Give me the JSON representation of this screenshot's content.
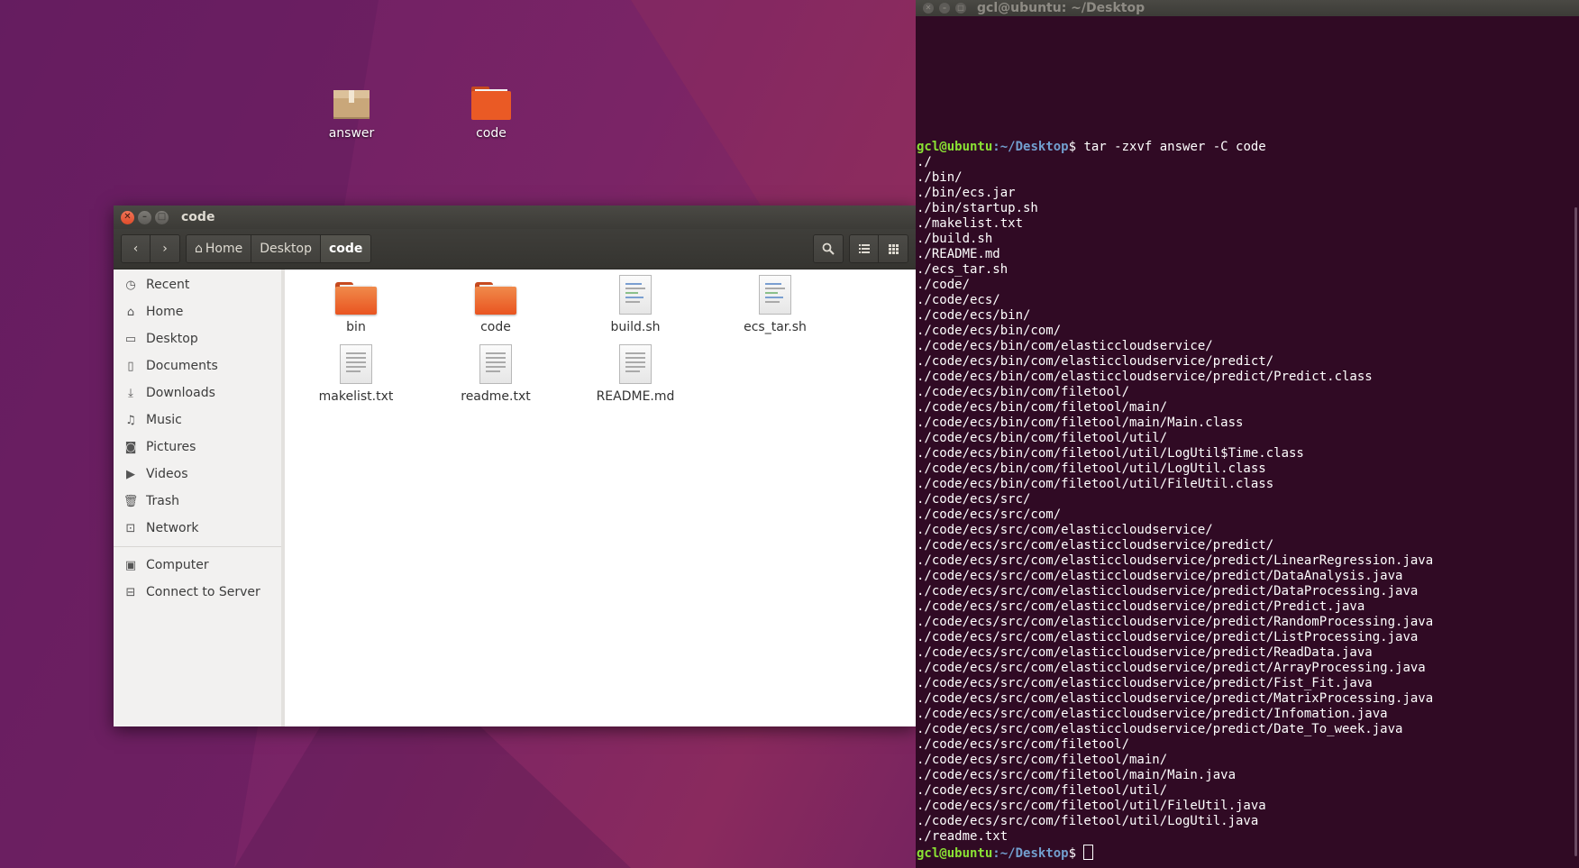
{
  "desktop": {
    "icons": [
      {
        "label": "answer"
      },
      {
        "label": "code"
      }
    ]
  },
  "file_manager": {
    "title": "code",
    "path": [
      "Home",
      "Desktop",
      "code"
    ],
    "sidebar": {
      "places": [
        "Recent",
        "Home",
        "Desktop",
        "Documents",
        "Downloads",
        "Music",
        "Pictures",
        "Videos",
        "Trash",
        "Network"
      ],
      "other": [
        "Computer",
        "Connect to Server"
      ]
    },
    "files": [
      {
        "name": "bin"
      },
      {
        "name": "code"
      },
      {
        "name": "build.sh"
      },
      {
        "name": "ecs_tar.sh"
      },
      {
        "name": "makelist.txt"
      },
      {
        "name": "readme.txt"
      },
      {
        "name": "README.md"
      }
    ]
  },
  "terminal": {
    "title": "gcl@ubuntu: ~/Desktop",
    "prompt_user": "gcl@ubuntu",
    "prompt_path": ":~/Desktop",
    "command": "$ tar -zxvf answer -C code",
    "final_prompt_suffix": "$ ",
    "output": [
      "./",
      "./bin/",
      "./bin/ecs.jar",
      "./bin/startup.sh",
      "./makelist.txt",
      "./build.sh",
      "./README.md",
      "./ecs_tar.sh",
      "./code/",
      "./code/ecs/",
      "./code/ecs/bin/",
      "./code/ecs/bin/com/",
      "./code/ecs/bin/com/elasticcloudservice/",
      "./code/ecs/bin/com/elasticcloudservice/predict/",
      "./code/ecs/bin/com/elasticcloudservice/predict/Predict.class",
      "./code/ecs/bin/com/filetool/",
      "./code/ecs/bin/com/filetool/main/",
      "./code/ecs/bin/com/filetool/main/Main.class",
      "./code/ecs/bin/com/filetool/util/",
      "./code/ecs/bin/com/filetool/util/LogUtil$Time.class",
      "./code/ecs/bin/com/filetool/util/LogUtil.class",
      "./code/ecs/bin/com/filetool/util/FileUtil.class",
      "./code/ecs/src/",
      "./code/ecs/src/com/",
      "./code/ecs/src/com/elasticcloudservice/",
      "./code/ecs/src/com/elasticcloudservice/predict/",
      "./code/ecs/src/com/elasticcloudservice/predict/LinearRegression.java",
      "./code/ecs/src/com/elasticcloudservice/predict/DataAnalysis.java",
      "./code/ecs/src/com/elasticcloudservice/predict/DataProcessing.java",
      "./code/ecs/src/com/elasticcloudservice/predict/Predict.java",
      "./code/ecs/src/com/elasticcloudservice/predict/RandomProcessing.java",
      "./code/ecs/src/com/elasticcloudservice/predict/ListProcessing.java",
      "./code/ecs/src/com/elasticcloudservice/predict/ReadData.java",
      "./code/ecs/src/com/elasticcloudservice/predict/ArrayProcessing.java",
      "./code/ecs/src/com/elasticcloudservice/predict/Fist_Fit.java",
      "./code/ecs/src/com/elasticcloudservice/predict/MatrixProcessing.java",
      "./code/ecs/src/com/elasticcloudservice/predict/Infomation.java",
      "./code/ecs/src/com/elasticcloudservice/predict/Date_To_week.java",
      "./code/ecs/src/com/filetool/",
      "./code/ecs/src/com/filetool/main/",
      "./code/ecs/src/com/filetool/main/Main.java",
      "./code/ecs/src/com/filetool/util/",
      "./code/ecs/src/com/filetool/util/FileUtil.java",
      "./code/ecs/src/com/filetool/util/LogUtil.java",
      "./readme.txt"
    ]
  }
}
